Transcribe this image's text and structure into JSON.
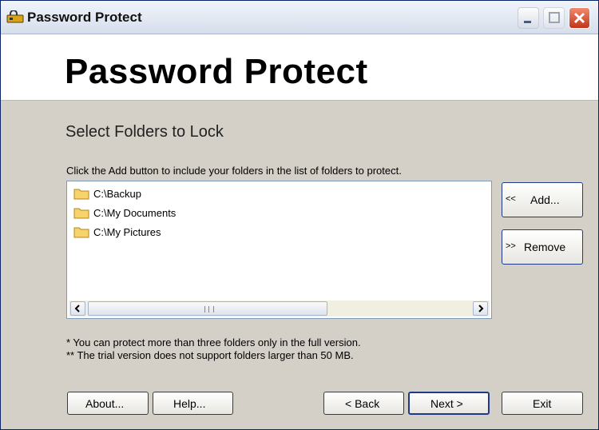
{
  "window": {
    "title": "Password Protect",
    "app_icon": "lock-icon"
  },
  "title_controls": [
    "minimize-icon",
    "maximize-icon",
    "close-icon"
  ],
  "header": {
    "title": "Password Protect"
  },
  "section": {
    "title": "Select Folders to Lock",
    "instruction": "Click the Add button to include your folders in the list of folders to protect."
  },
  "folders": [
    {
      "path": "C:\\Backup",
      "icon": "folder-icon"
    },
    {
      "path": "C:\\My Documents",
      "icon": "folder-icon"
    },
    {
      "path": "C:\\My Pictures",
      "icon": "folder-icon"
    }
  ],
  "side_buttons": {
    "add": {
      "arrow": "<<",
      "label": "Add..."
    },
    "remove": {
      "arrow": ">>",
      "label": "Remove"
    }
  },
  "notes": [
    "*  You can protect more than three folders only in the full version.",
    "** The trial version does not support folders larger than 50 MB."
  ],
  "footer": {
    "about": "About...",
    "help": "Help...",
    "back": "< Back",
    "next": "Next >",
    "exit": "Exit"
  },
  "colors": {
    "close_button": "#c2361a",
    "header_bg": "#ffffff",
    "dialog_bg": "#d4d0c8",
    "default_border": "#1f3a8a"
  }
}
